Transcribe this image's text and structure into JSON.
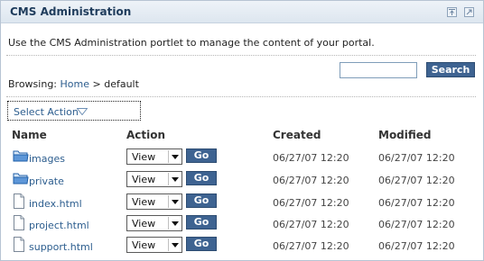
{
  "portlet": {
    "title": "CMS Administration",
    "intro": "Use the CMS Administration portlet to manage the content of your portal."
  },
  "search": {
    "value": "",
    "button_label": "Search"
  },
  "browsing": {
    "prefix": "Browsing:",
    "home_link": "Home",
    "separator": ">",
    "current": "default"
  },
  "select_action": {
    "label": "Select Action"
  },
  "table": {
    "headers": {
      "name": "Name",
      "action": "Action",
      "created": "Created",
      "modified": "Modified"
    },
    "rows": [
      {
        "name": "images",
        "type": "folder",
        "action": "View",
        "go": "Go",
        "created": "06/27/07 12:20",
        "modified": "06/27/07 12:20"
      },
      {
        "name": "private",
        "type": "folder",
        "action": "View",
        "go": "Go",
        "created": "06/27/07 12:20",
        "modified": "06/27/07 12:20"
      },
      {
        "name": "index.html",
        "type": "file",
        "action": "View",
        "go": "Go",
        "created": "06/27/07 12:20",
        "modified": "06/27/07 12:20"
      },
      {
        "name": "project.html",
        "type": "file",
        "action": "View",
        "go": "Go",
        "created": "06/27/07 12:20",
        "modified": "06/27/07 12:20"
      },
      {
        "name": "support.html",
        "type": "file",
        "action": "View",
        "go": "Go",
        "created": "06/27/07 12:20",
        "modified": "06/27/07 12:20"
      }
    ]
  },
  "icons": {
    "window_controls": [
      "minimize-icon",
      "maximize-icon"
    ],
    "folder": "folder-icon",
    "file": "file-icon",
    "dropdown": "triangle-down-icon"
  },
  "colors": {
    "button_bg": "#3e6391",
    "link": "#2c5d8e",
    "title": "#1f3c5c",
    "titlebar": "#dde6ef"
  }
}
